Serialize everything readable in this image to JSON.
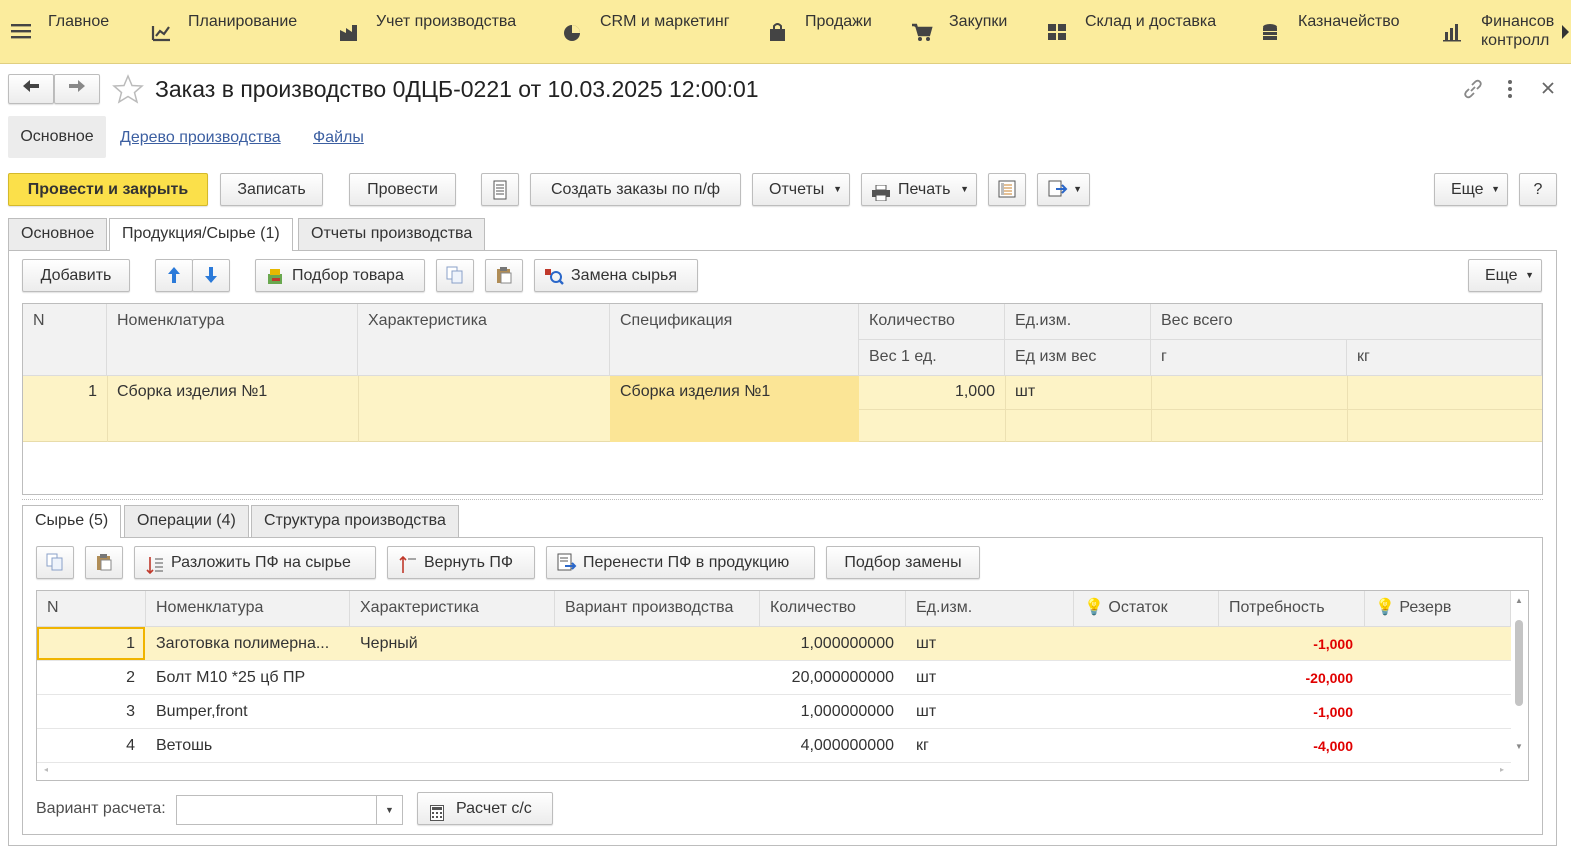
{
  "nav": [
    {
      "label": "Главное",
      "icon": "menu-icon"
    },
    {
      "label": "Планирование",
      "icon": "planning-icon"
    },
    {
      "label": "Учет производства",
      "icon": "factory-icon"
    },
    {
      "label": "CRM и маркетинг",
      "icon": "pie-chart-icon"
    },
    {
      "label": "Продажи",
      "icon": "bag-icon"
    },
    {
      "label": "Закупки",
      "icon": "cart-icon"
    },
    {
      "label": "Склад и доставка",
      "icon": "warehouse-icon"
    },
    {
      "label": "Казначейство",
      "icon": "coins-icon"
    },
    {
      "label": "Финансов",
      "label2": "контролл",
      "icon": "bar-chart-icon"
    }
  ],
  "title": "Заказ в производство 0ДЦБ-0221 от 10.03.2025 12:00:01",
  "section_tabs": [
    "Основное",
    "Дерево производства",
    "Файлы"
  ],
  "toolbar": {
    "post_close": "Провести и закрыть",
    "save": "Записать",
    "post": "Провести",
    "create_orders": "Создать заказы по п/ф",
    "reports": "Отчеты",
    "print": "Печать",
    "more": "Еще",
    "help": "?"
  },
  "tabs": [
    "Основное",
    "Продукция/Сырье (1)",
    "Отчеты производства"
  ],
  "products_toolbar": {
    "add": "Добавить",
    "pick": "Подбор товара",
    "replace": "Замена сырья",
    "more": "Еще"
  },
  "products_grid": {
    "headers": {
      "n": "N",
      "nom": "Номенклатура",
      "char": "Характеристика",
      "spec": "Спецификация",
      "qty": "Количество",
      "unit": "Ед.изм.",
      "weight_total": "Вес всего",
      "weight1": "Вес 1 ед.",
      "unit_weight": "Ед изм вес",
      "g": "г",
      "kg": "кг"
    },
    "rows": [
      {
        "n": "1",
        "nom": "Сборка изделия №1",
        "char": "",
        "spec": "Сборка изделия №1",
        "qty": "1,000",
        "unit": "шт"
      }
    ]
  },
  "sub_tabs": [
    "Сырье (5)",
    "Операции (4)",
    "Структура производства"
  ],
  "raw_toolbar": {
    "decompose": "Разложить ПФ на сырье",
    "return": "Вернуть ПФ",
    "transfer": "Перенести ПФ в продукцию",
    "pick_replace": "Подбор замены"
  },
  "raw_grid": {
    "headers": [
      "N",
      "Номенклатура",
      "Характеристика",
      "Вариант производства",
      "Количество",
      "Ед.изм.",
      "Остаток",
      "Потребность",
      "Резерв"
    ],
    "rows": [
      {
        "n": "1",
        "nom": "Заготовка полимерна...",
        "char": "Черный",
        "variant": "",
        "qty": "1,000000000",
        "unit": "шт",
        "stock": "",
        "need": "-1,000",
        "reserve": ""
      },
      {
        "n": "2",
        "nom": "Болт  М10 *25 цб ПР",
        "char": "",
        "variant": "",
        "qty": "20,000000000",
        "unit": "шт",
        "stock": "",
        "need": "-20,000",
        "reserve": ""
      },
      {
        "n": "3",
        "nom": "Bumper,front",
        "char": "",
        "variant": "",
        "qty": "1,000000000",
        "unit": "шт",
        "stock": "",
        "need": "-1,000",
        "reserve": ""
      },
      {
        "n": "4",
        "nom": "Ветошь",
        "char": "",
        "variant": "",
        "qty": "4,000000000",
        "unit": "кг",
        "stock": "",
        "need": "-4,000",
        "reserve": ""
      }
    ]
  },
  "bottom": {
    "calc_variant_label": "Вариант расчета:",
    "calc_variant_value": "",
    "calc_button": "Расчет с/с"
  },
  "colors": {
    "nav_bg": "#fbec9d",
    "accent_button": "#fbe04a",
    "selected_row": "#fdf3c6",
    "negative": "#e00000",
    "link": "#3c5fa1"
  }
}
